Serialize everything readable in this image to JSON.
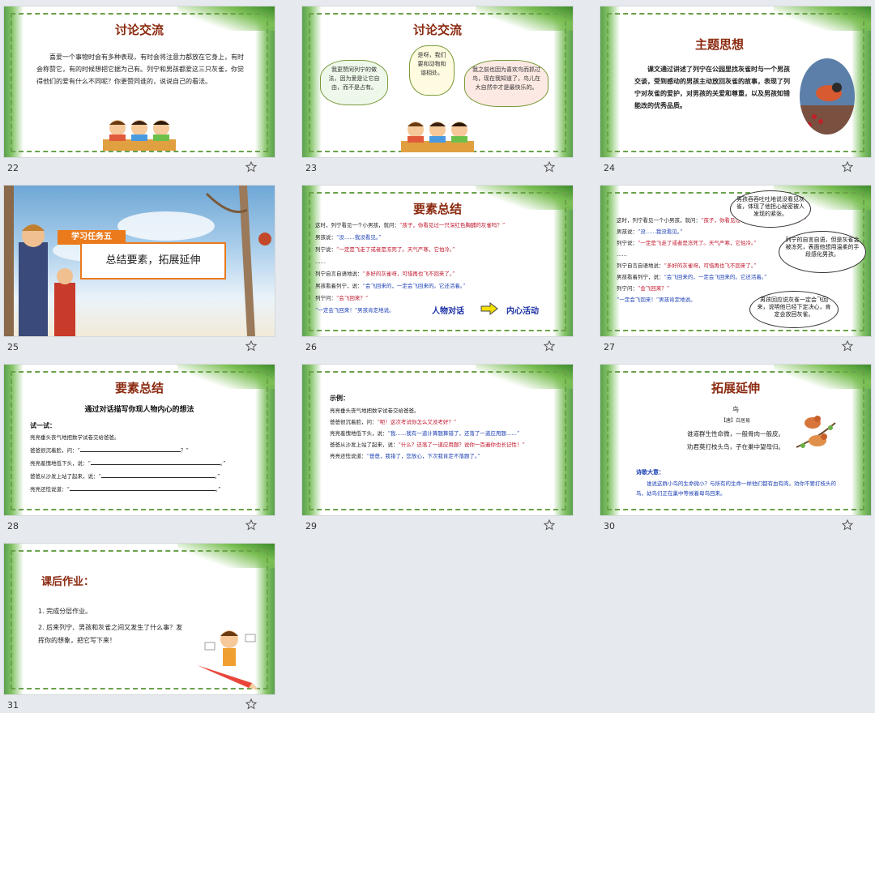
{
  "slides": [
    {
      "num": "22",
      "title": "讨论交流",
      "body": "喜爱一个事物时会有多种表现，有时会将注意力都放在它身上，有时会称赞它，有的时候想把它据为己有。列宁和男孩都爱这三只灰雀，你觉得他们的爱有什么不同呢？你更赞同谁的，说说自己的看法。"
    },
    {
      "num": "23",
      "title": "讨论交流",
      "bubble1": "我更赞同列宁的做法，因为爱是让它自由，而不是占有。",
      "bubble2": "是呀，我们要和动物和谐相处。",
      "bubble3": "我之前也因为喜欢鸟而抓过鸟，现在我知道了，鸟儿在大自然中才是最快乐的。"
    },
    {
      "num": "24",
      "title": "主题思想",
      "body": "课文通过讲述了列宁在公园里找灰雀时与一个男孩交谈，受到感动的男孩主动放回灰雀的故事，表现了列宁对灰雀的爱护，对男孩的关爱和尊重，以及男孩知错能改的优秀品质。"
    },
    {
      "num": "25",
      "tag": "学习任务五",
      "heading": "总结要素，拓展延伸"
    },
    {
      "num": "26",
      "title": "要素总结",
      "lines": [
        {
          "a": "这时，列宁看见一个小男孩，就问：",
          "b": "“孩子，你看见过一只深红色胸脯的灰雀吗？”"
        },
        {
          "a": "男孩说：",
          "b": "“没……我没看见。”"
        },
        {
          "a": "列宁说：",
          "b": "“一定是飞走了或者是冻死了。天气严寒，它怕冷。”"
        },
        {
          "a": "……",
          "b": ""
        },
        {
          "a": "列宁自言自语地说：",
          "b": "“多好的灰雀呀，可惜再也飞不回来了。”"
        },
        {
          "a": "男孩看着列宁，说：",
          "b": "“会飞回来的，一定会飞回来的。它还活着。”"
        },
        {
          "a": "列宁问：",
          "b": "“会飞回来？”"
        },
        {
          "a": "",
          "b": "“一定会飞回来！”男孩肯定地说。"
        }
      ],
      "flow_left": "人物对话",
      "flow_right": "内心活动"
    },
    {
      "num": "27",
      "lines": [
        {
          "a": "这时，列宁看见一个小男孩，就问：",
          "b": "“孩子，你看见过一只深红色胸脯的灰雀吗？”"
        },
        {
          "a": "男孩说：",
          "b": "“没……我没看见。”"
        },
        {
          "a": "列宁说：",
          "b": "“一定是飞走了或者是冻死了。天气严寒，它怕冷。”"
        },
        {
          "a": "……",
          "b": ""
        },
        {
          "a": "列宁自言自语地说：",
          "b": "“多好的灰雀呀，可惜再也飞不回来了。”"
        },
        {
          "a": "男孩看着列宁，说：",
          "b": "“会飞回来的，一定会飞回来的。它还活着。”"
        },
        {
          "a": "列宁问：",
          "b": "“会飞回来？”"
        },
        {
          "a": "",
          "b": "“一定会飞回来！”男孩肯定地说。"
        }
      ],
      "cloud1": "男孩吞吞吐吐地说没看见灰雀，体现了他担心秘密被人发现的紧张。",
      "cloud2": "列宁的自言自语，但是灰雀会被冻死，表面他想用温柔的手段感化男孩。",
      "cloud3": "男孩回应说灰雀一定会飞回来，说明他已经下定决心，肯定会放回灰雀。"
    },
    {
      "num": "28",
      "title": "要素总结",
      "subtitle": "通过对话描写你现人物内心的想法",
      "try": "试一试：",
      "lines": [
        "亮亮垂头丧气地把数学试卷交给爸爸。",
        "爸爸很沉着脸，问：“",
        "亮亮羞愧地低下头，说：“",
        "爸爸从沙发上站了起来，说：“",
        "亮亮还怯说道：“"
      ]
    },
    {
      "num": "29",
      "example": "示例：",
      "lines": [
        {
          "a": "亮亮垂头丧气地把数学试卷交给爸爸。",
          "b": ""
        },
        {
          "a": "爸爸很沉着脸，问：",
          "b": "“呃！这次考试你怎么又没考好？”"
        },
        {
          "a": "亮亮羞愧地低下头，说：",
          "b": "“我……我有一道计算题算错了，还落了一道应用题……”"
        },
        {
          "a": "爸爸从沙发上站了起来，说：",
          "b": "“什么？还落了一道应用题？说你一百遍你也长记性！”"
        },
        {
          "a": "亮亮还怯说道：",
          "b": "“爸爸，我错了，您放心，下次我肯定不落题了。”"
        }
      ]
    },
    {
      "num": "30",
      "title": "拓展延伸",
      "poem_title": "鸟",
      "author": "【唐】白居易",
      "poem1": "谁道群生性命微，一般骨肉一般皮。",
      "poem2": "劝君莫打枝头鸟，子在巢中望母归。",
      "meaning_label": "诗歌大意：",
      "meaning": "谁说这群小鸟的生命微小？与所有的生命一样他们都有血有肉。劝你不要打枝头的鸟，幼鸟们正在巢中等候着母鸟回来。"
    },
    {
      "num": "31",
      "title": "课后作业：",
      "item1": "1. 完成分层作业。",
      "item2": "2. 后来列宁、男孩和灰雀之间又发生了什么事？发挥你的想象，把它写下来！"
    }
  ]
}
